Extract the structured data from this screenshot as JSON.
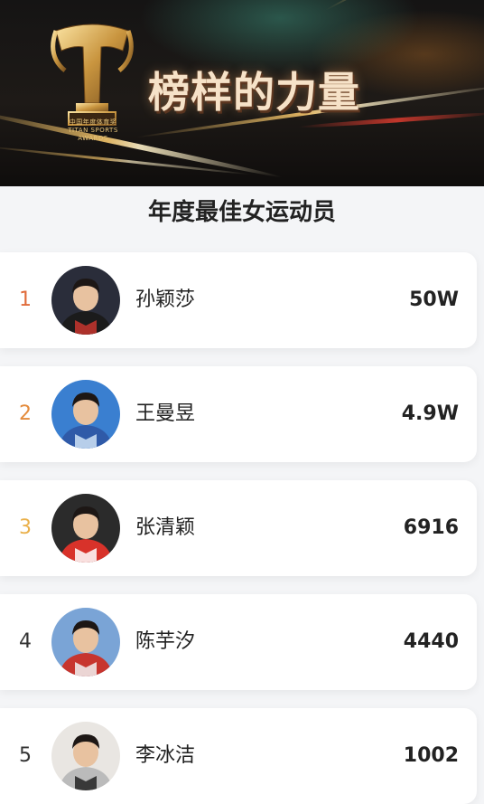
{
  "banner": {
    "slogan": "榜样的力量",
    "brand_cn": "中国年度体育奖",
    "brand_en": "TITAN SPORTS AWARDS",
    "trophy_letter": "T"
  },
  "section": {
    "title": "年度最佳女运动员"
  },
  "colors": {
    "rank_1": "#e06b3a",
    "rank_2": "#e48b3c",
    "rank_3": "#eab04a",
    "rank_default": "#333333",
    "gold": "#e3b45c"
  },
  "athletes": [
    {
      "rank": "1",
      "name": "孙颖莎",
      "votes": "50W",
      "avatar_icon": "athlete-photo"
    },
    {
      "rank": "2",
      "name": "王曼昱",
      "votes": "4.9W",
      "avatar_icon": "athlete-photo"
    },
    {
      "rank": "3",
      "name": "张清颖",
      "votes": "6916",
      "avatar_icon": "athlete-photo"
    },
    {
      "rank": "4",
      "name": "陈芋汐",
      "votes": "4440",
      "avatar_icon": "athlete-photo"
    },
    {
      "rank": "5",
      "name": "李冰洁",
      "votes": "1002",
      "avatar_icon": "athlete-photo"
    }
  ]
}
